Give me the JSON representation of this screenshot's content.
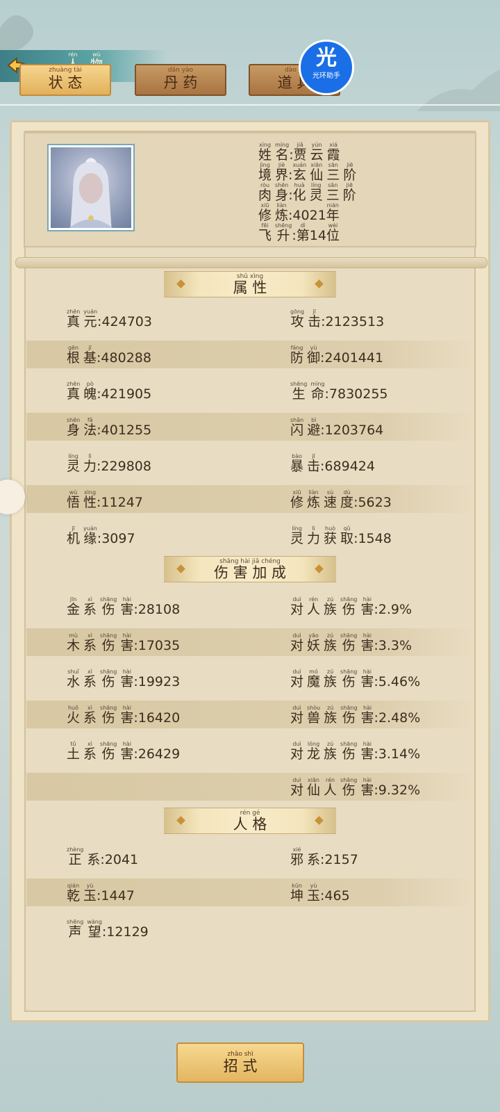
{
  "nav": {
    "title": {
      "py": [
        "rén",
        "wù"
      ],
      "hz": [
        "人",
        "物"
      ]
    },
    "tabs": [
      {
        "py": "zhuàng tài",
        "label": "状态"
      },
      {
        "py": "dān yào",
        "label": "丹药"
      },
      {
        "py": "dào jù",
        "label": "道具"
      }
    ]
  },
  "watermark": {
    "glyph": "光",
    "text": "光环助手"
  },
  "profile": {
    "lines": [
      {
        "py": [
          "xìng",
          "míng"
        ],
        "hz": [
          "姓",
          "名"
        ],
        "val_py": [
          "jiǎ",
          "yún",
          "xiá"
        ],
        "val_hz": [
          "贾",
          "云",
          "霞"
        ]
      },
      {
        "py": [
          "jìng",
          "jiè"
        ],
        "hz": [
          "境",
          "界"
        ],
        "val_py": [
          "xuán",
          "xiān",
          "sān",
          "jiē"
        ],
        "val_hz": [
          "玄",
          "仙",
          "三",
          "阶"
        ]
      },
      {
        "py": [
          "ròu",
          "shēn"
        ],
        "hz": [
          "肉",
          "身"
        ],
        "val_py": [
          "huà",
          "líng",
          "sān",
          "jiē"
        ],
        "val_hz": [
          "化",
          "灵",
          "三",
          "阶"
        ]
      },
      {
        "py": [
          "xiū",
          "liàn"
        ],
        "hz": [
          "修",
          "炼"
        ],
        "value": ":4021",
        "val_py": [
          "nián"
        ],
        "val_hz": [
          "年"
        ]
      },
      {
        "py": [
          "fēi",
          "shēng"
        ],
        "hz": [
          "飞",
          "升"
        ],
        "value": ":第14",
        "val_py": [
          "dì",
          "wèi"
        ],
        "val_hz": [
          "第",
          "位"
        ]
      }
    ]
  },
  "sections": {
    "attributes": {
      "py": [
        "shǔ",
        "xìng"
      ],
      "hz": [
        "属",
        "性"
      ]
    },
    "damage": {
      "py": [
        "shāng",
        "hài",
        "jiā",
        "chéng"
      ],
      "hz": [
        "伤",
        "害",
        "加",
        "成"
      ]
    },
    "personality": {
      "py": [
        "rén",
        "gé"
      ],
      "hz": [
        "人",
        "格"
      ]
    }
  },
  "attributes": [
    {
      "l": {
        "py": [
          "zhēn",
          "yuán"
        ],
        "hz": [
          "真",
          "元"
        ],
        "value": ":424703"
      },
      "r": {
        "py": [
          "gōng",
          "jī"
        ],
        "hz": [
          "攻",
          "击"
        ],
        "value": ":2123513"
      }
    },
    {
      "l": {
        "py": [
          "gēn",
          "jī"
        ],
        "hz": [
          "根",
          "基"
        ],
        "value": ":480288"
      },
      "r": {
        "py": [
          "fáng",
          "yù"
        ],
        "hz": [
          "防",
          "御"
        ],
        "value": ":2401441"
      }
    },
    {
      "l": {
        "py": [
          "zhēn",
          "pò"
        ],
        "hz": [
          "真",
          "魄"
        ],
        "value": ":421905"
      },
      "r": {
        "py": [
          "shēng",
          "mìng"
        ],
        "hz": [
          "生",
          "命"
        ],
        "value": ":7830255"
      }
    },
    {
      "l": {
        "py": [
          "shēn",
          "fǎ"
        ],
        "hz": [
          "身",
          "法"
        ],
        "value": ":401255"
      },
      "r": {
        "py": [
          "shǎn",
          "bì"
        ],
        "hz": [
          "闪",
          "避"
        ],
        "value": ":1203764"
      }
    },
    {
      "l": {
        "py": [
          "líng",
          "lì"
        ],
        "hz": [
          "灵",
          "力"
        ],
        "value": ":229808"
      },
      "r": {
        "py": [
          "bào",
          "jī"
        ],
        "hz": [
          "暴",
          "击"
        ],
        "value": ":689424"
      }
    },
    {
      "l": {
        "py": [
          "wù",
          "xìng"
        ],
        "hz": [
          "悟",
          "性"
        ],
        "value": ":11247"
      },
      "r": {
        "py": [
          "xiū",
          "liàn",
          "sù",
          "dù"
        ],
        "hz": [
          "修",
          "炼",
          "速",
          "度"
        ],
        "value": ":5623"
      }
    },
    {
      "l": {
        "py": [
          "jī",
          "yuán"
        ],
        "hz": [
          "机",
          "缘"
        ],
        "value": ":3097"
      },
      "r": {
        "py": [
          "líng",
          "lì",
          "huò",
          "qǔ"
        ],
        "hz": [
          "灵",
          "力",
          "获",
          "取"
        ],
        "value": ":1548"
      }
    }
  ],
  "damage": [
    {
      "l": {
        "py": [
          "jīn",
          "xì",
          "shāng",
          "hài"
        ],
        "hz": [
          "金",
          "系",
          "伤",
          "害"
        ],
        "value": ":28108"
      },
      "r": {
        "py": [
          "duì",
          "rén",
          "zú",
          "shāng",
          "hài"
        ],
        "hz": [
          "对",
          "人",
          "族",
          "伤",
          "害"
        ],
        "value": ":2.9%"
      }
    },
    {
      "l": {
        "py": [
          "mù",
          "xì",
          "shāng",
          "hài"
        ],
        "hz": [
          "木",
          "系",
          "伤",
          "害"
        ],
        "value": ":17035"
      },
      "r": {
        "py": [
          "duì",
          "yāo",
          "zú",
          "shāng",
          "hài"
        ],
        "hz": [
          "对",
          "妖",
          "族",
          "伤",
          "害"
        ],
        "value": ":3.3%"
      }
    },
    {
      "l": {
        "py": [
          "shuǐ",
          "xì",
          "shāng",
          "hài"
        ],
        "hz": [
          "水",
          "系",
          "伤",
          "害"
        ],
        "value": ":19923"
      },
      "r": {
        "py": [
          "duì",
          "mó",
          "zú",
          "shāng",
          "hài"
        ],
        "hz": [
          "对",
          "魔",
          "族",
          "伤",
          "害"
        ],
        "value": ":5.46%"
      }
    },
    {
      "l": {
        "py": [
          "huǒ",
          "xì",
          "shāng",
          "hài"
        ],
        "hz": [
          "火",
          "系",
          "伤",
          "害"
        ],
        "value": ":16420"
      },
      "r": {
        "py": [
          "duì",
          "shòu",
          "zú",
          "shāng",
          "hài"
        ],
        "hz": [
          "对",
          "兽",
          "族",
          "伤",
          "害"
        ],
        "value": ":2.48%"
      }
    },
    {
      "l": {
        "py": [
          "tǔ",
          "xì",
          "shāng",
          "hài"
        ],
        "hz": [
          "土",
          "系",
          "伤",
          "害"
        ],
        "value": ":26429"
      },
      "r": {
        "py": [
          "duì",
          "lóng",
          "zú",
          "shāng",
          "hài"
        ],
        "hz": [
          "对",
          "龙",
          "族",
          "伤",
          "害"
        ],
        "value": ":3.14%"
      }
    },
    {
      "l": null,
      "r": {
        "py": [
          "duì",
          "xiān",
          "rén",
          "shāng",
          "hài"
        ],
        "hz": [
          "对",
          "仙",
          "人",
          "伤",
          "害"
        ],
        "value": ":9.32%"
      }
    }
  ],
  "personality": [
    {
      "l": {
        "py": [
          "zhèng"
        ],
        "hz": [
          "正",
          "系"
        ],
        "value": ":2041"
      },
      "r": {
        "py": [
          "xié"
        ],
        "hz": [
          "邪",
          "系"
        ],
        "value": ":2157"
      }
    },
    {
      "l": {
        "py": [
          "qián",
          "yù"
        ],
        "hz": [
          "乾",
          "玉"
        ],
        "value": ":1447"
      },
      "r": {
        "py": [
          "kūn",
          "yù"
        ],
        "hz": [
          "坤",
          "玉"
        ],
        "value": ":465"
      }
    },
    {
      "l": {
        "py": [
          "shēng",
          "wàng"
        ],
        "hz": [
          "声",
          "望"
        ],
        "value": ":12129"
      },
      "r": null
    }
  ],
  "moves_button": {
    "py": [
      "zhāo",
      "shì"
    ],
    "hz": [
      "招",
      "式"
    ]
  }
}
